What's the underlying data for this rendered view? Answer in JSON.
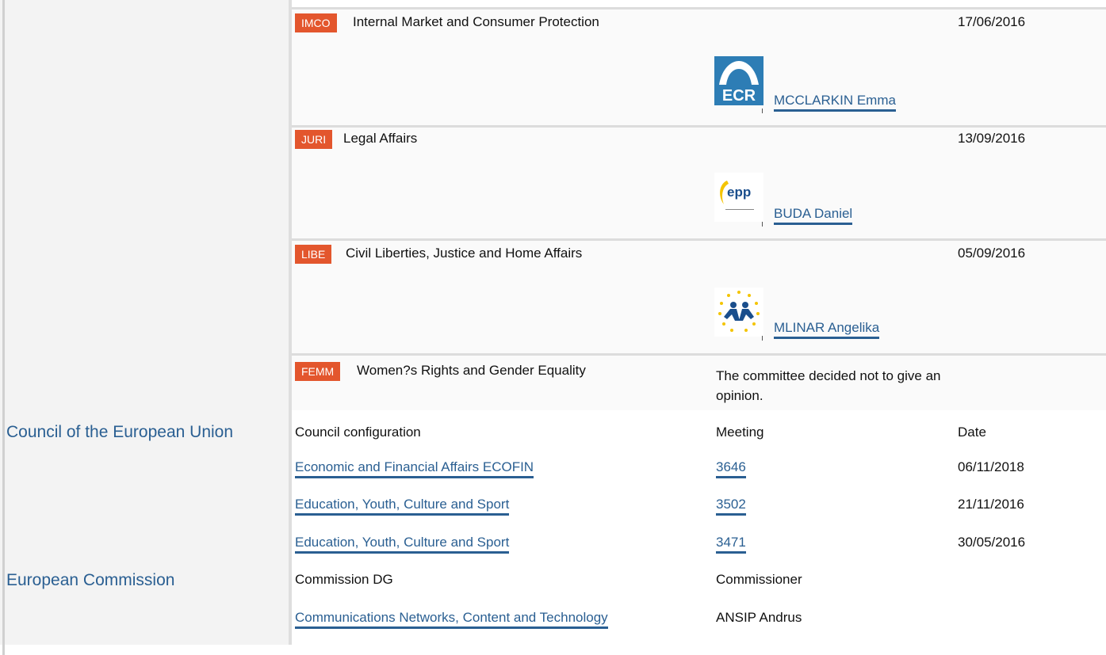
{
  "committees": [
    {
      "abbr": "IMCO",
      "name": "Internal Market and Consumer Protection",
      "date": "17/06/2016",
      "logo": "ecr-logo",
      "rapporteur": "MCCLARKIN Emma",
      "logo_text": "ECR"
    },
    {
      "abbr": "JURI",
      "name": "Legal Affairs",
      "date": "13/09/2016",
      "logo": "epp-logo",
      "rapporteur": "BUDA Daniel",
      "logo_text": "epp"
    },
    {
      "abbr": "LIBE",
      "name": "Civil Liberties, Justice and Home Affairs",
      "date": "05/09/2016",
      "logo": "alde-logo",
      "rapporteur": "MLINAR Angelika"
    },
    {
      "abbr": "FEMM",
      "name": "Women?s Rights and Gender Equality",
      "note": "The committee decided not to give an opinion."
    }
  ],
  "council": {
    "title": "Council of the European Union",
    "headers": {
      "config": "Council configuration",
      "meeting": "Meeting",
      "date": "Date"
    },
    "rows": [
      {
        "config": "Economic and Financial Affairs ECOFIN",
        "meeting": "3646",
        "date": "06/11/2018"
      },
      {
        "config": "Education, Youth, Culture and Sport",
        "meeting": "3502",
        "date": "21/11/2016"
      },
      {
        "config": "Education, Youth, Culture and Sport",
        "meeting": "3471",
        "date": "30/05/2016"
      }
    ]
  },
  "commission": {
    "title": "European Commission",
    "headers": {
      "dg": "Commission DG",
      "commissioner": "Commissioner"
    },
    "rows": [
      {
        "dg": "Communications Networks, Content and Technology",
        "commissioner": "ANSIP Andrus"
      }
    ]
  },
  "colors": {
    "accent": "#e3562d",
    "link": "#2a5f92"
  }
}
